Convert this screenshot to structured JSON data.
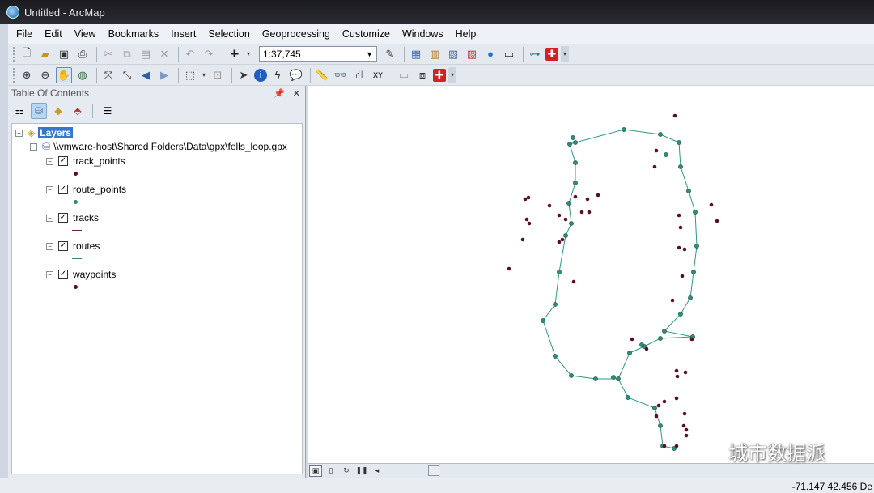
{
  "window": {
    "title": "Untitled - ArcMap"
  },
  "menu": [
    "File",
    "Edit",
    "View",
    "Bookmarks",
    "Insert",
    "Selection",
    "Geoprocessing",
    "Customize",
    "Windows",
    "Help"
  ],
  "toolbar": {
    "scale": "1:37,745"
  },
  "toc": {
    "title": "Table Of Contents",
    "root": "Layers",
    "source": "\\\\vmware-host\\Shared Folders\\Data\\gpx\\fells_loop.gpx",
    "layers": [
      {
        "name": "track_points",
        "symbol": "point",
        "color": "#5a0f1e"
      },
      {
        "name": "route_points",
        "symbol": "point",
        "color": "#2d8a78"
      },
      {
        "name": "tracks",
        "symbol": "line",
        "color": "#6b2330"
      },
      {
        "name": "routes",
        "symbol": "line",
        "color": "#2d8a78"
      },
      {
        "name": "waypoints",
        "symbol": "point",
        "color": "#5a0f1e"
      }
    ]
  },
  "status": {
    "coords": "-71.147  42.456 De"
  },
  "watermark": {
    "text": "城市数据派"
  },
  "colors": {
    "route": "#2d9a84",
    "route_point": "#2e8e79",
    "waypoint": "#5c0f20",
    "layers_highlight": "#3478c8"
  }
}
